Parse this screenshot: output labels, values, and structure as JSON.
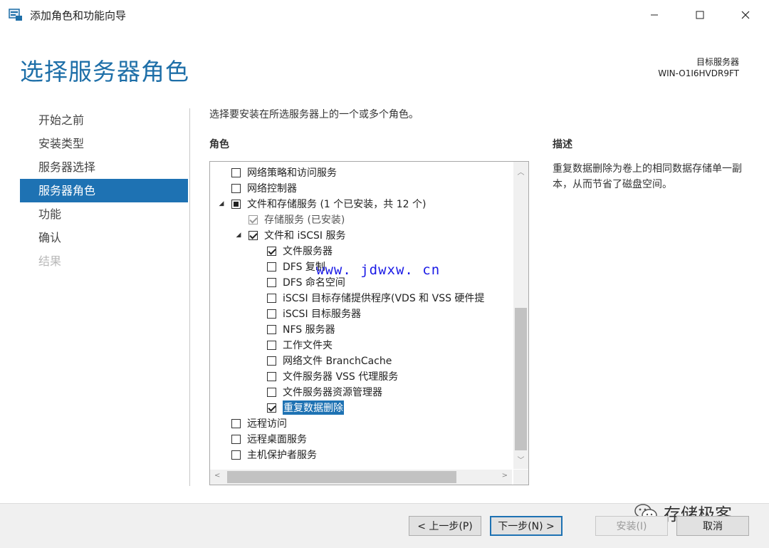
{
  "window": {
    "title": "添加角色和功能向导",
    "minimize_icon": "minimize-icon",
    "maximize_icon": "maximize-icon",
    "close_icon": "close-icon"
  },
  "header": {
    "page_title": "选择服务器角色",
    "target_label": "目标服务器",
    "target_value": "WIN-O1I6HVDR9FT"
  },
  "nav": {
    "items": [
      {
        "label": "开始之前",
        "state": "normal"
      },
      {
        "label": "安装类型",
        "state": "normal"
      },
      {
        "label": "服务器选择",
        "state": "normal"
      },
      {
        "label": "服务器角色",
        "state": "selected"
      },
      {
        "label": "功能",
        "state": "normal"
      },
      {
        "label": "确认",
        "state": "normal"
      },
      {
        "label": "结果",
        "state": "disabled"
      }
    ]
  },
  "main": {
    "instruction": "选择要安装在所选服务器上的一个或多个角色。",
    "roles_heading": "角色",
    "description_heading": "描述",
    "description_text": "重复数据删除为卷上的相同数据存储单一副本，从而节省了磁盘空间。"
  },
  "roles_tree": [
    {
      "label": "网络策略和访问服务",
      "level": 0,
      "state": "unchecked",
      "expander": ""
    },
    {
      "label": "网络控制器",
      "level": 0,
      "state": "unchecked",
      "expander": ""
    },
    {
      "label": "文件和存储服务 (1 个已安装，共 12 个)",
      "level": 0,
      "state": "indeterminate",
      "expander": "◢"
    },
    {
      "label": "存储服务 (已安装)",
      "level": 1,
      "state": "checked-disabled",
      "expander": ""
    },
    {
      "label": "文件和 iSCSI 服务",
      "level": 1,
      "state": "checked",
      "expander": "◢"
    },
    {
      "label": "文件服务器",
      "level": 2,
      "state": "checked",
      "expander": ""
    },
    {
      "label": "DFS 复制",
      "level": 2,
      "state": "unchecked",
      "expander": ""
    },
    {
      "label": "DFS 命名空间",
      "level": 2,
      "state": "unchecked",
      "expander": ""
    },
    {
      "label": "iSCSI 目标存储提供程序(VDS 和 VSS 硬件提",
      "level": 2,
      "state": "unchecked",
      "expander": ""
    },
    {
      "label": "iSCSI 目标服务器",
      "level": 2,
      "state": "unchecked",
      "expander": ""
    },
    {
      "label": "NFS 服务器",
      "level": 2,
      "state": "unchecked",
      "expander": ""
    },
    {
      "label": "工作文件夹",
      "level": 2,
      "state": "unchecked",
      "expander": ""
    },
    {
      "label": "网络文件 BranchCache",
      "level": 2,
      "state": "unchecked",
      "expander": ""
    },
    {
      "label": "文件服务器 VSS 代理服务",
      "level": 2,
      "state": "unchecked",
      "expander": ""
    },
    {
      "label": "文件服务器资源管理器",
      "level": 2,
      "state": "unchecked",
      "expander": ""
    },
    {
      "label": "重复数据删除",
      "level": 2,
      "state": "checked",
      "expander": "",
      "highlight": true
    },
    {
      "label": "远程访问",
      "level": 0,
      "state": "unchecked",
      "expander": ""
    },
    {
      "label": "远程桌面服务",
      "level": 0,
      "state": "unchecked",
      "expander": ""
    },
    {
      "label": "主机保护者服务",
      "level": 0,
      "state": "unchecked",
      "expander": ""
    }
  ],
  "watermark": "www. jdwxw. cn",
  "footer": {
    "prev_label": "< 上一步(P)",
    "next_label": "下一步(N) >",
    "install_label": "安装(I)",
    "cancel_label": "取消",
    "brand_text": "存储极客"
  },
  "colors": {
    "accent": "#1e72b3",
    "title_blue": "#1e6fa8",
    "watermark": "#1a1ae6"
  }
}
